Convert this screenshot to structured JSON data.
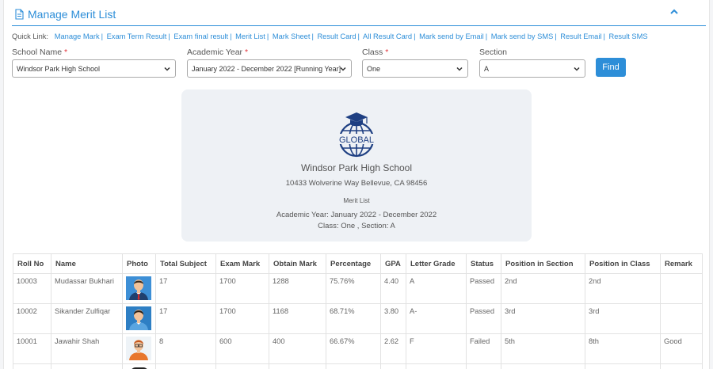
{
  "header": {
    "title": "Manage Merit List"
  },
  "quick_links": {
    "label": "Quick Link:",
    "items": [
      "Manage Mark",
      "Exam Term Result",
      "Exam final result",
      "Merit List",
      "Mark Sheet",
      "Result Card",
      "All Result Card",
      "Mark send by Email",
      "Mark send by SMS",
      "Result Email",
      "Result SMS"
    ]
  },
  "filters": {
    "school": {
      "label": "School Name",
      "required": "*",
      "value": "Windsor Park High School"
    },
    "year": {
      "label": "Academic Year",
      "required": "*",
      "value": "January 2022 - December 2022 [Running Year]"
    },
    "class": {
      "label": "Class",
      "required": "*",
      "value": "One"
    },
    "section": {
      "label": "Section",
      "value": "A"
    },
    "find_label": "Find"
  },
  "card": {
    "logo_text": "GLOBAL",
    "school": "Windsor Park High School",
    "address": "10433 Wolverine Way Bellevue, CA 98456",
    "doc_title": "Merit List",
    "academic_year": "Academic Year: January 2022 - December 2022",
    "class_section": "Class: One , Section: A"
  },
  "table": {
    "columns": [
      "Roll No",
      "Name",
      "Photo",
      "Total Subject",
      "Exam Mark",
      "Obtain Mark",
      "Percentage",
      "GPA",
      "Letter Grade",
      "Status",
      "Position in Section",
      "Position in Class",
      "Remark"
    ],
    "rows": [
      {
        "roll": "10003",
        "name": "Mudassar Bukhari",
        "photo": "avatar-male-red-tie",
        "total_subject": "17",
        "exam_mark": "1700",
        "obtain_mark": "1288",
        "percentage": "75.76%",
        "gpa": "4.40",
        "grade": "A",
        "status": "Passed",
        "pos_section": "2nd",
        "pos_class": "2nd",
        "remark": ""
      },
      {
        "roll": "10002",
        "name": "Sikander Zulfiqar",
        "photo": "avatar-male-blue",
        "total_subject": "17",
        "exam_mark": "1700",
        "obtain_mark": "1168",
        "percentage": "68.71%",
        "gpa": "3.80",
        "grade": "A-",
        "status": "Passed",
        "pos_section": "3rd",
        "pos_class": "3rd",
        "remark": ""
      },
      {
        "roll": "10001",
        "name": "Jawahir Shah",
        "photo": "avatar-male-glasses-orange",
        "total_subject": "8",
        "exam_mark": "600",
        "obtain_mark": "400",
        "percentage": "66.67%",
        "gpa": "2.62",
        "grade": "F",
        "status": "Failed",
        "pos_section": "5th",
        "pos_class": "8th",
        "remark": "Good"
      }
    ]
  },
  "colors": {
    "accent": "#2d8ed8",
    "required": "#e0343c",
    "card_bg": "#eef1f5",
    "logo": "#1e3f82"
  }
}
